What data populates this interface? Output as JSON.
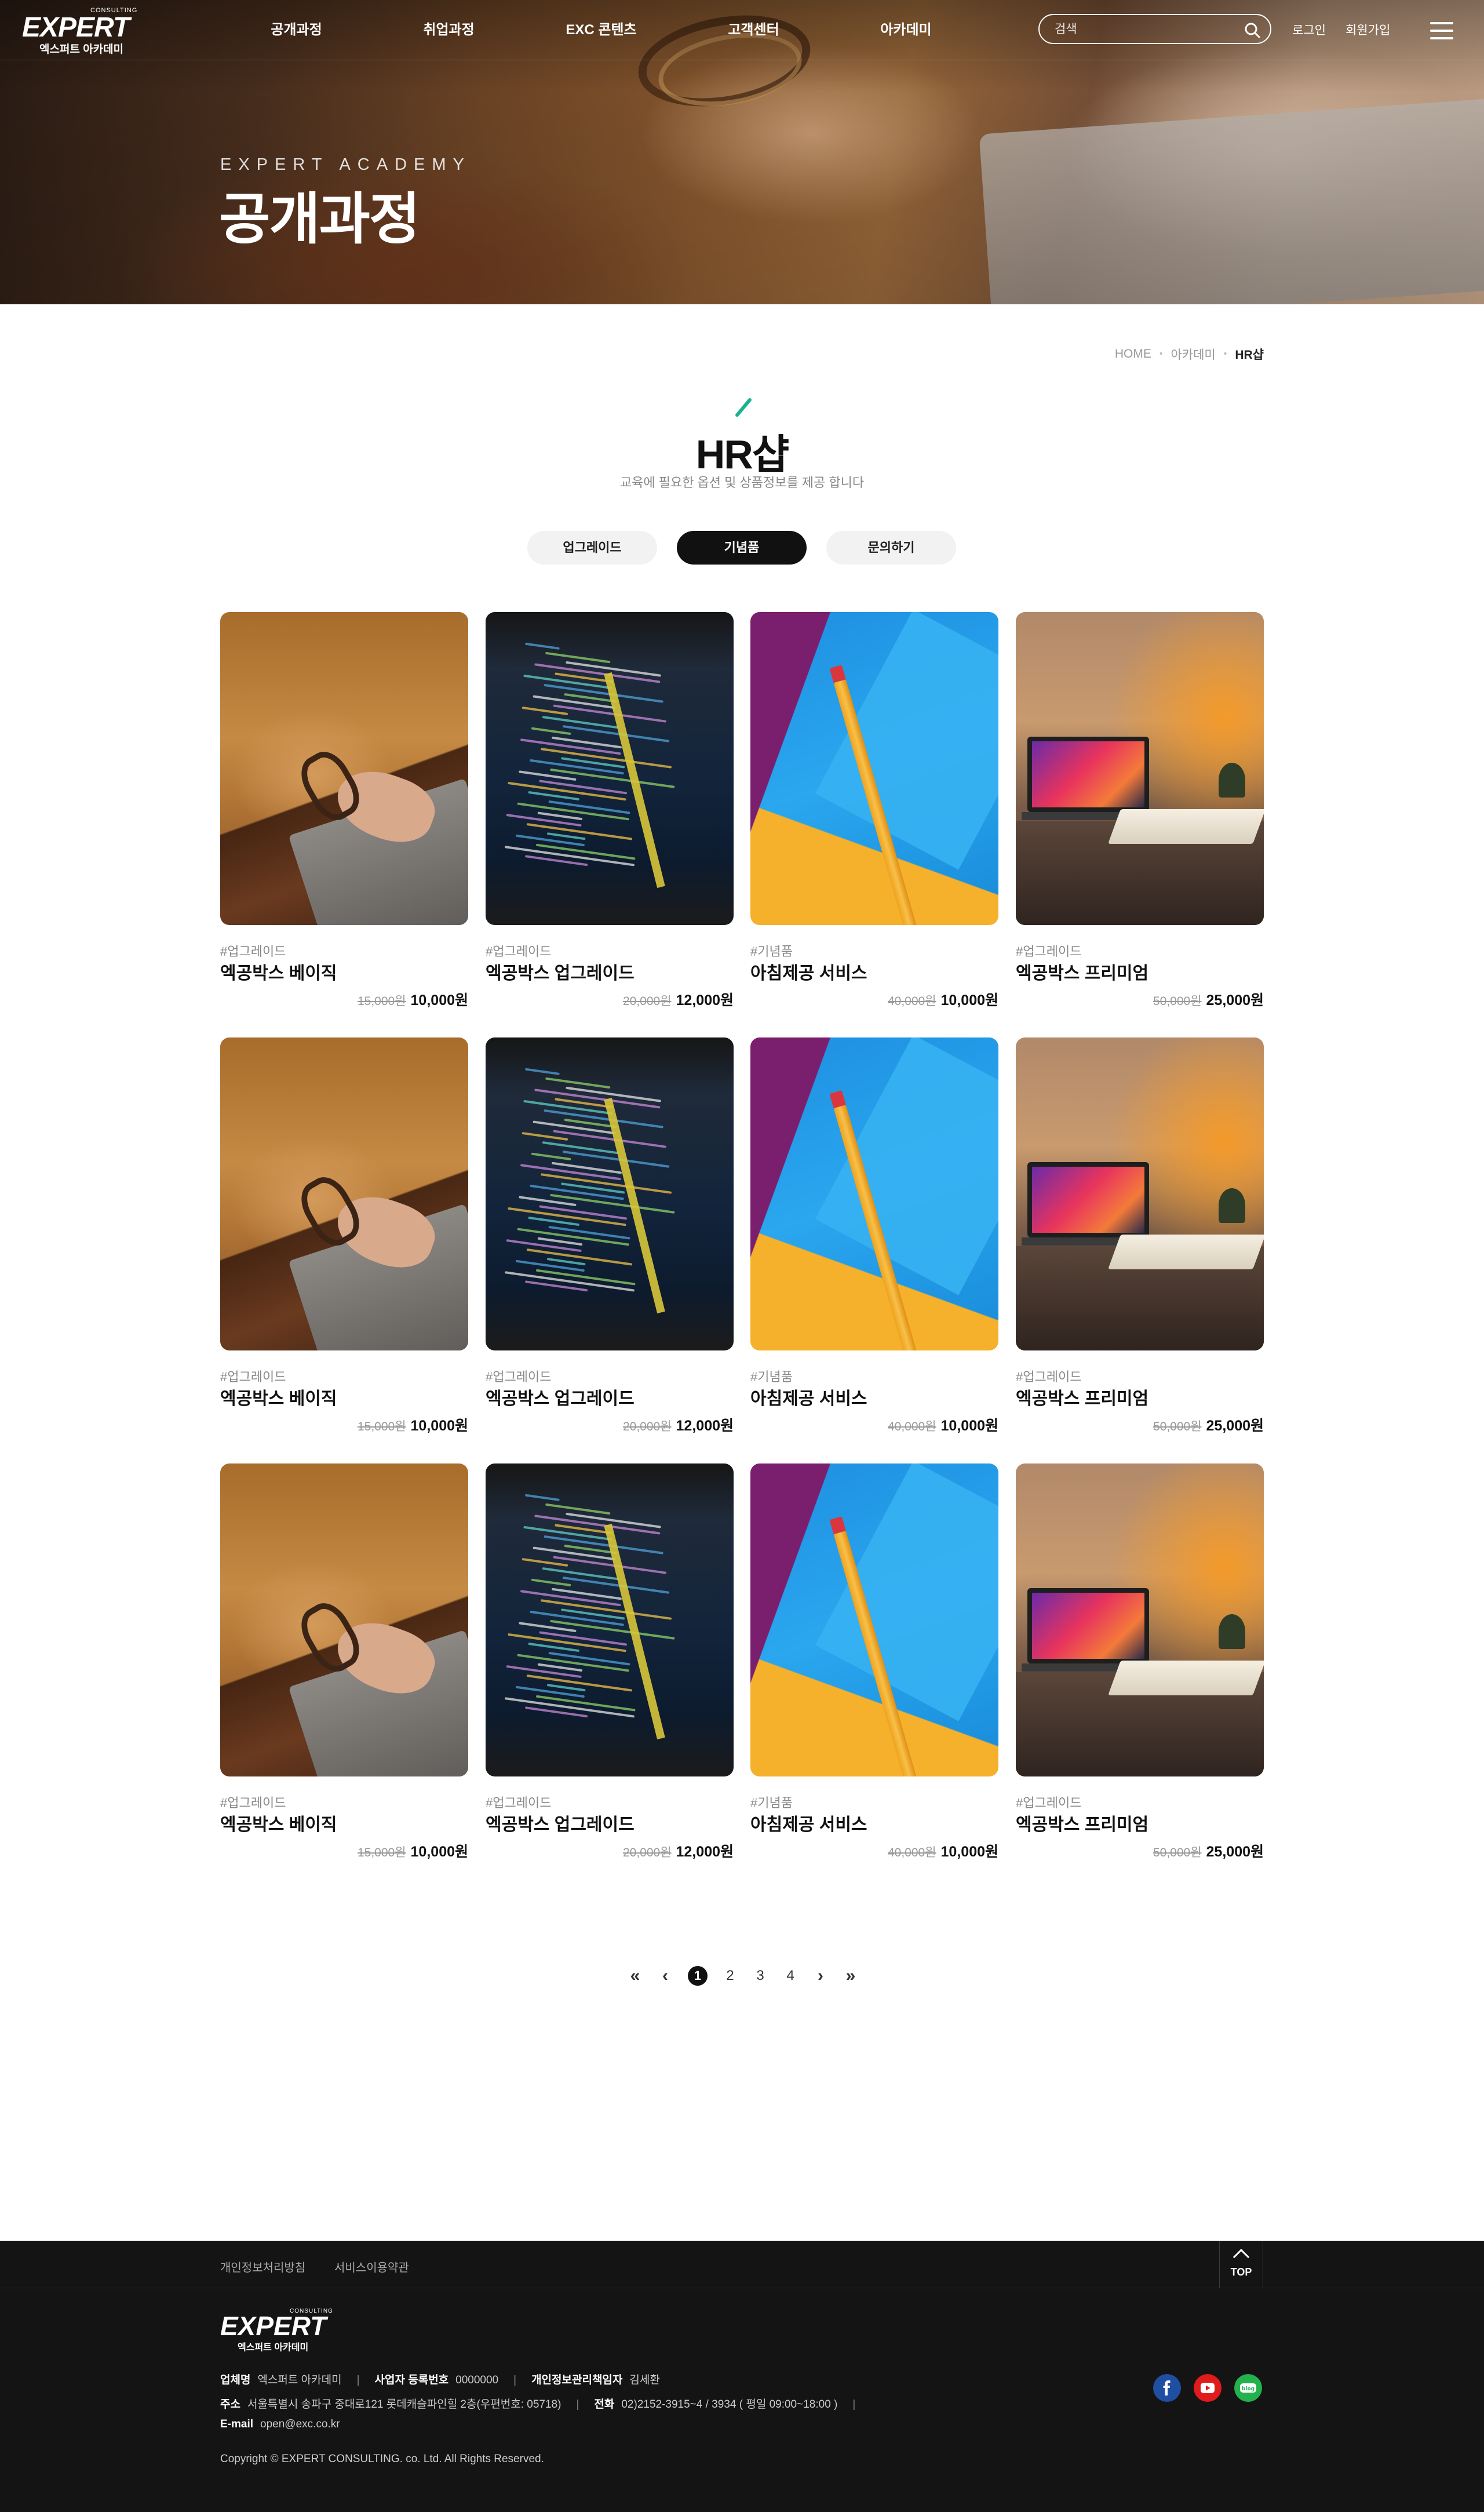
{
  "header": {
    "logo_word": "EXPERT",
    "logo_consulting": "CONSULTING",
    "logo_sub": "엑스퍼트 아카데미",
    "nav": [
      "공개과정",
      "취업과정",
      "EXC 콘텐츠",
      "고객센터",
      "아카데미"
    ],
    "search_placeholder": "검색",
    "login": "로그인",
    "signup": "회원가입"
  },
  "hero": {
    "eyebrow": "EXPERT ACADEMY",
    "title": "공개과정"
  },
  "breadcrumb": [
    "HOME",
    "아카데미",
    "HR샵"
  ],
  "page": {
    "title": "HR샵",
    "subtitle": "교육에 필요한 옵션 및 상품정보를 제공 합니다",
    "accent_color": "#19b38f"
  },
  "tabs": [
    {
      "label": "업그레이드",
      "active": false
    },
    {
      "label": "기념품",
      "active": true
    },
    {
      "label": "문의하기",
      "active": false
    }
  ],
  "products": [
    {
      "tag": "#업그레이드",
      "name": "엑공박스 베이직",
      "old_price": "15,000원",
      "price": "10,000원",
      "image": "sweater-laptop"
    },
    {
      "tag": "#업그레이드",
      "name": "엑공박스 업그레이드",
      "old_price": "20,000원",
      "price": "12,000원",
      "image": "code-screen"
    },
    {
      "tag": "#기념품",
      "name": "아침제공 서비스",
      "old_price": "40,000원",
      "price": "10,000원",
      "image": "pencil"
    },
    {
      "tag": "#업그레이드",
      "name": "엑공박스 프리미엄",
      "old_price": "50,000원",
      "price": "25,000원",
      "image": "laptop-desk"
    },
    {
      "tag": "#업그레이드",
      "name": "엑공박스 베이직",
      "old_price": "15,000원",
      "price": "10,000원",
      "image": "sweater-laptop"
    },
    {
      "tag": "#업그레이드",
      "name": "엑공박스 업그레이드",
      "old_price": "20,000원",
      "price": "12,000원",
      "image": "code-screen"
    },
    {
      "tag": "#기념품",
      "name": "아침제공 서비스",
      "old_price": "40,000원",
      "price": "10,000원",
      "image": "pencil"
    },
    {
      "tag": "#업그레이드",
      "name": "엑공박스 프리미엄",
      "old_price": "50,000원",
      "price": "25,000원",
      "image": "laptop-desk"
    },
    {
      "tag": "#업그레이드",
      "name": "엑공박스 베이직",
      "old_price": "15,000원",
      "price": "10,000원",
      "image": "sweater-laptop"
    },
    {
      "tag": "#업그레이드",
      "name": "엑공박스 업그레이드",
      "old_price": "20,000원",
      "price": "12,000원",
      "image": "code-screen"
    },
    {
      "tag": "#기념품",
      "name": "아침제공 서비스",
      "old_price": "40,000원",
      "price": "10,000원",
      "image": "pencil"
    },
    {
      "tag": "#업그레이드",
      "name": "엑공박스 프리미엄",
      "old_price": "50,000원",
      "price": "25,000원",
      "image": "laptop-desk"
    }
  ],
  "pagination": {
    "pages": [
      "1",
      "2",
      "3",
      "4"
    ],
    "current": "1"
  },
  "footer": {
    "links": [
      "개인정보처리방침",
      "서비스이용약관"
    ],
    "top": "TOP",
    "logo_word": "EXPERT",
    "logo_consulting": "CONSULTING",
    "logo_sub": "엑스퍼트 아카데미",
    "company_label": "업체명",
    "company": "엑스퍼트 아카데미",
    "biz_label": "사업자 등록번호",
    "biz": "0000000",
    "privacy_label": "개인정보관리책임자",
    "privacy": "김세환",
    "address_label": "주소",
    "address": "서울특별시 송파구 중대로121 롯데캐슬파인힐 2층(우편번호: 05718)",
    "phone_label": "전화",
    "phone": "02)2152-3915~4 / 3934 ( 평일 09:00~18:00 )",
    "email_label": "E-mail",
    "email": "open@exc.co.kr",
    "copyright": "Copyright © EXPERT CONSULTING. co. Ltd. All Rights Reserved.",
    "social": [
      {
        "icon": "facebook-icon",
        "color": "#1f4fa3"
      },
      {
        "icon": "youtube-icon",
        "color": "#e01b1b"
      },
      {
        "icon": "blog-icon",
        "color": "#22b14c"
      }
    ]
  }
}
